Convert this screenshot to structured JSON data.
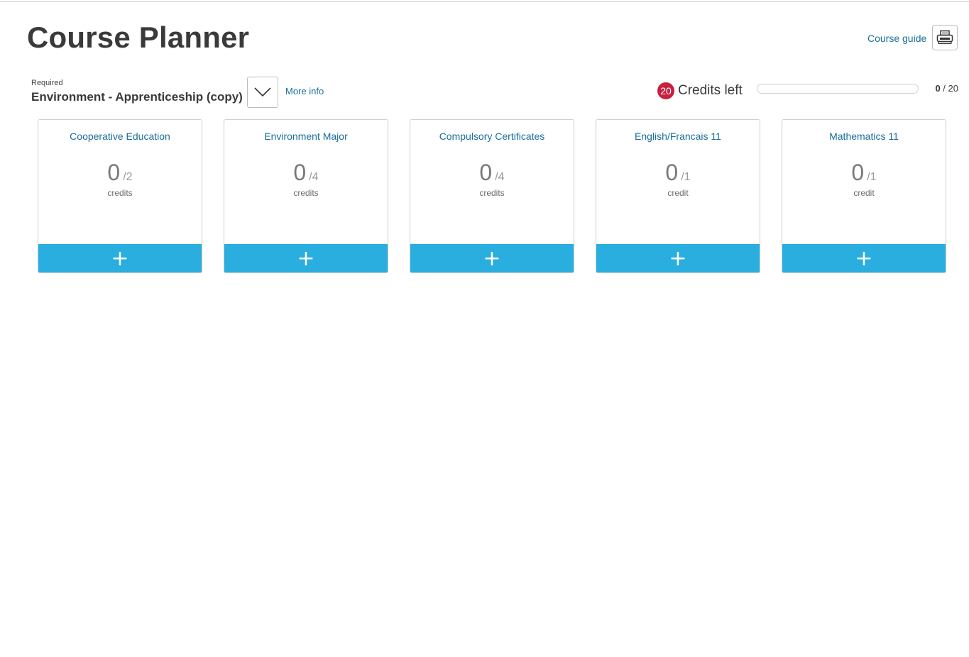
{
  "header": {
    "title": "Course Planner",
    "course_guide_label": "Course guide",
    "print_icon": "printer-icon"
  },
  "program": {
    "required_label": "Required",
    "name": "Environment - Apprenticeship (copy)",
    "dropdown_icon": "chevron-down-icon",
    "more_info_label": "More info"
  },
  "credits": {
    "left_count": "20",
    "left_label": "Credits left",
    "earned": "0",
    "separator": " / ",
    "total": "20",
    "progress_percent": 0
  },
  "colors": {
    "accent": "#2aaddf",
    "link": "#1a6e9a",
    "badge": "#c8203f",
    "title": "#3a3a3a"
  },
  "cards": [
    {
      "title": "Cooperative Education",
      "earned": "0",
      "required": "/2",
      "unit": "credits",
      "add_label": "+"
    },
    {
      "title": "Environment Major",
      "earned": "0",
      "required": "/4",
      "unit": "credits",
      "add_label": "+"
    },
    {
      "title": "Compulsory Certificates",
      "earned": "0",
      "required": "/4",
      "unit": "credits",
      "add_label": "+"
    },
    {
      "title": "English/Francais 11",
      "earned": "0",
      "required": "/1",
      "unit": "credit",
      "add_label": "+"
    },
    {
      "title": "Mathematics 11",
      "earned": "0",
      "required": "/1",
      "unit": "credit",
      "add_label": "+"
    }
  ]
}
